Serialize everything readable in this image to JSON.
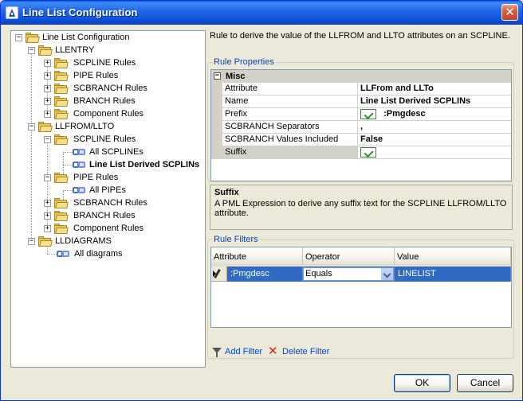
{
  "window": {
    "title": "Line List Configuration"
  },
  "tree": {
    "root": "Line List Configuration",
    "llentry": {
      "label": "LLENTRY",
      "children": [
        "SCPLINE Rules",
        "PIPE Rules",
        "SCBRANCH Rules",
        "BRANCH Rules",
        "Component Rules"
      ]
    },
    "llfrom": {
      "label": "LLFROM/LLTO",
      "scpline": {
        "label": "SCPLINE Rules",
        "children": [
          "All SCPLINEs",
          "Line List Derived SCPLINs"
        ]
      },
      "pipe": {
        "label": "PIPE Rules",
        "children": [
          "All PIPEs"
        ]
      },
      "others": [
        "SCBRANCH Rules",
        "BRANCH Rules",
        "Component Rules"
      ]
    },
    "lldiagrams": {
      "label": "LLDIAGRAMS",
      "children": [
        "All diagrams"
      ]
    }
  },
  "description": "Rule to derive the value of the LLFROM and LLTO attributes on an SCPLINE.",
  "properties": {
    "group_title": "Rule Properties",
    "category": "Misc",
    "rows": [
      {
        "name": "Attribute",
        "value": "LLFrom and LLTo"
      },
      {
        "name": "Name",
        "value": "Line List Derived SCPLINs"
      },
      {
        "name": "Prefix",
        "value": ":Pmgdesc"
      },
      {
        "name": "SCBRANCH Separators",
        "value": ","
      },
      {
        "name": "SCBRANCH Values Included",
        "value": "False"
      },
      {
        "name": "Suffix",
        "value": ""
      }
    ]
  },
  "help": {
    "title": "Suffix",
    "body": "A PML Expression to derive any suffix text for the SCPLINE LLFROM/LLTO attribute."
  },
  "filters": {
    "group_title": "Rule Filters",
    "columns": [
      "Attribute",
      "Operator",
      "Value"
    ],
    "row": {
      "attribute": ":Pmgdesc",
      "operator": "Equals",
      "value": "LINELIST"
    }
  },
  "actions": {
    "add_filter": "Add Filter",
    "delete_filter": "Delete Filter"
  },
  "buttons": {
    "ok": "OK",
    "cancel": "Cancel"
  },
  "colors": {
    "title_bar": "#0A5FE6",
    "link": "#0046D5",
    "selection": "#316AC5",
    "close": "#D8633F"
  }
}
